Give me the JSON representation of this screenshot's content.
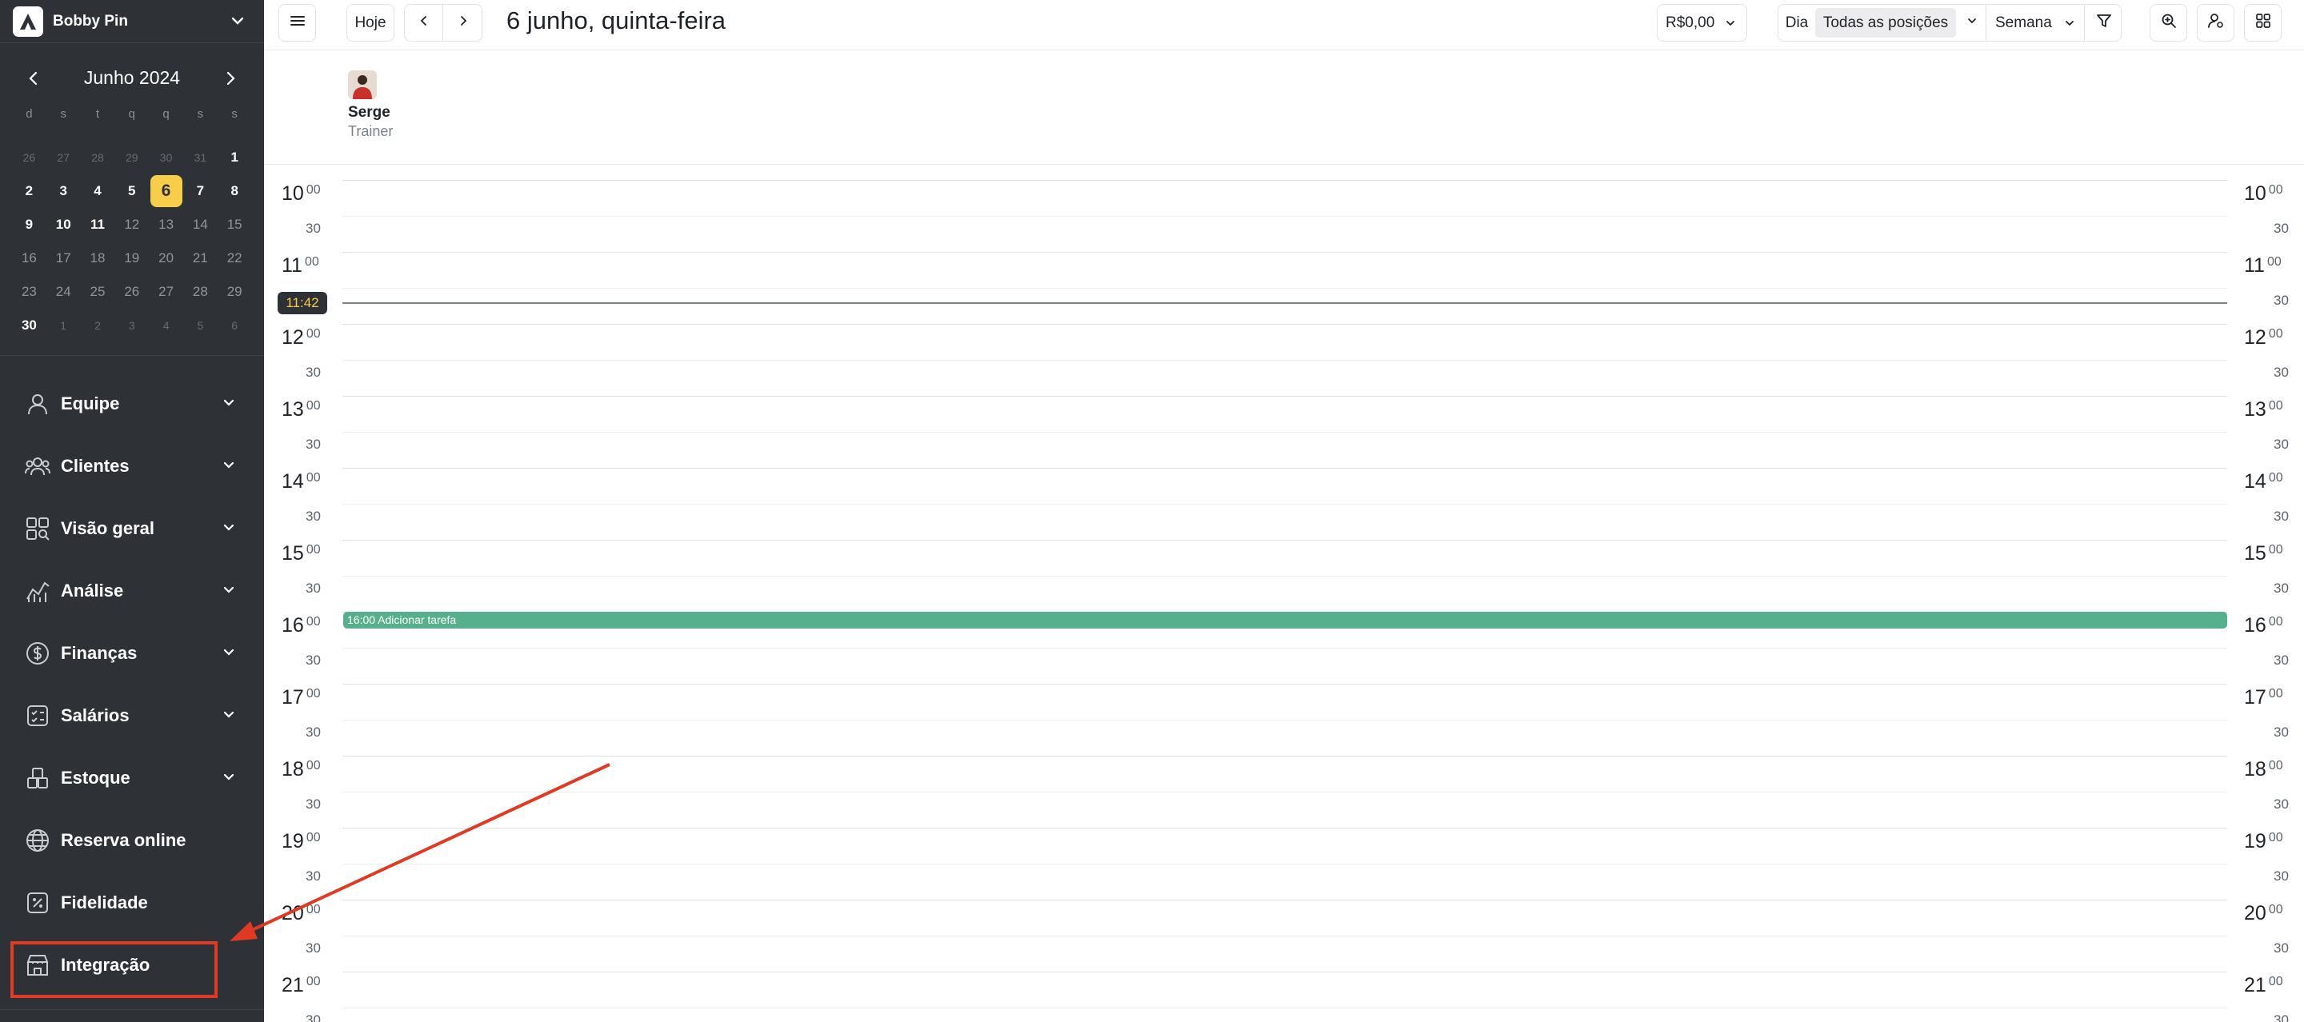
{
  "business": {
    "name": "Bobby Pin"
  },
  "mini_calendar": {
    "title": "Junho 2024",
    "weekdays": [
      "d",
      "s",
      "t",
      "q",
      "q",
      "s",
      "s"
    ],
    "weeks": [
      [
        "26",
        "27",
        "28",
        "29",
        "30",
        "31",
        "1"
      ],
      [
        "2",
        "3",
        "4",
        "5",
        "6",
        "7",
        "8"
      ],
      [
        "9",
        "10",
        "11",
        "12",
        "13",
        "14",
        "15"
      ],
      [
        "16",
        "17",
        "18",
        "19",
        "20",
        "21",
        "22"
      ],
      [
        "23",
        "24",
        "25",
        "26",
        "27",
        "28",
        "29"
      ],
      [
        "30",
        "1",
        "2",
        "3",
        "4",
        "5",
        "6"
      ]
    ],
    "selected_day": "6"
  },
  "nav": [
    {
      "label": "Equipe",
      "icon": "user-icon",
      "expandable": true
    },
    {
      "label": "Clientes",
      "icon": "users-icon",
      "expandable": true
    },
    {
      "label": "Visão geral",
      "icon": "overview-icon",
      "expandable": true
    },
    {
      "label": "Análise",
      "icon": "analytics-icon",
      "expandable": true
    },
    {
      "label": "Finanças",
      "icon": "dollar-icon",
      "expandable": true
    },
    {
      "label": "Salários",
      "icon": "salary-icon",
      "expandable": true
    },
    {
      "label": "Estoque",
      "icon": "stock-icon",
      "expandable": true
    },
    {
      "label": "Reserva online",
      "icon": "globe-icon",
      "expandable": false
    },
    {
      "label": "Fidelidade",
      "icon": "loyalty-icon",
      "expandable": false
    },
    {
      "label": "Integração",
      "icon": "store-icon",
      "expandable": false
    }
  ],
  "toolbar": {
    "today_label": "Hoje",
    "prev_icon": "chevron-left-icon",
    "next_icon": "chevron-right-icon",
    "date_title": "6 junho, quinta-feira",
    "revenue_label": "R$0,00",
    "view_day_label": "Dia",
    "positions_label": "Todas as posições",
    "view_week_label": "Semana"
  },
  "staff": {
    "name": "Serge",
    "role": "Trainer"
  },
  "timeline": {
    "hours": [
      "10",
      "11",
      "12",
      "13",
      "14",
      "15",
      "16",
      "17",
      "18",
      "19",
      "20",
      "21"
    ],
    "minute_zero": "00",
    "minute_half": "30",
    "now_label": "11:42"
  },
  "event": {
    "label": "16:00 Adicionar tarefa",
    "color": "#56b08d"
  },
  "colors": {
    "sidebar_bg": "#2e3236",
    "accent": "#f7cd4a",
    "annotation": "#e03a25"
  }
}
